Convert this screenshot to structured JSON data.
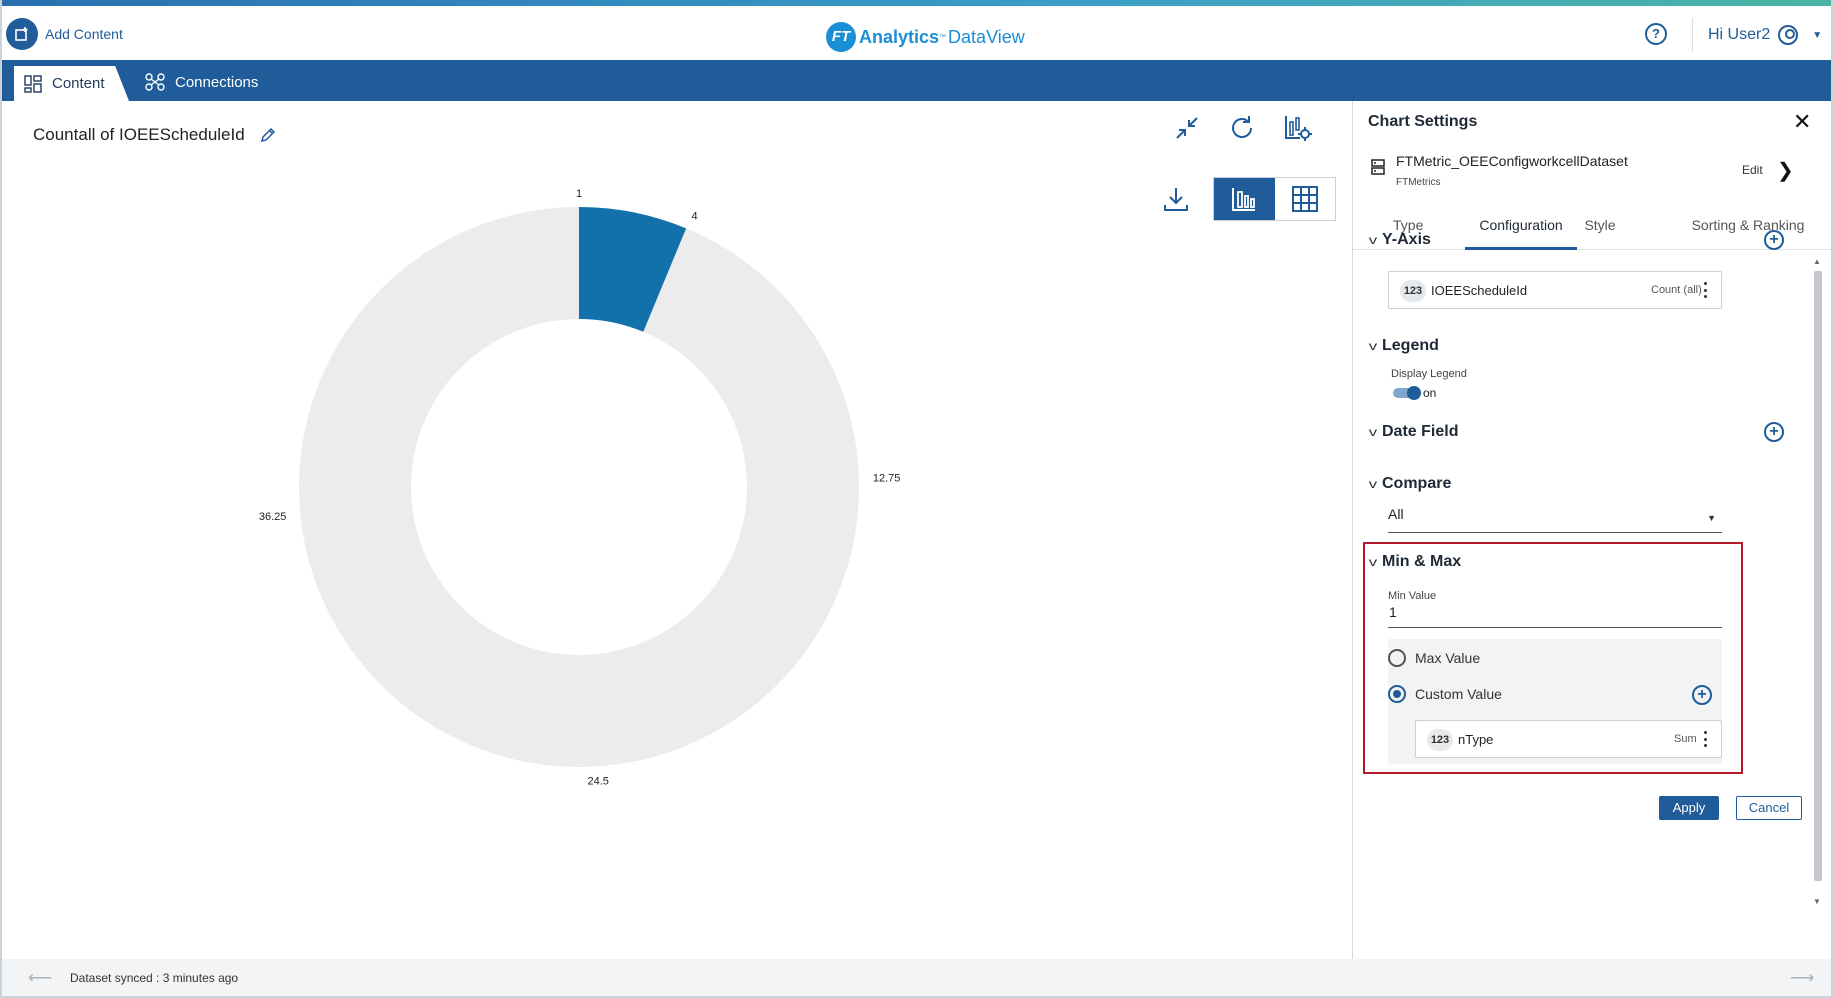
{
  "header": {
    "add_content_label": "Add Content",
    "brand_badge": "FT",
    "brand_analytics": "Analytics",
    "brand_tm": "™",
    "brand_dataview": "DataView",
    "help_icon": "question-circle-icon",
    "user_greeting": "Hi User2"
  },
  "tabs": [
    {
      "label": "Content",
      "icon": "grid-icon",
      "active": true
    },
    {
      "label": "Connections",
      "icon": "connections-icon",
      "active": false
    }
  ],
  "main": {
    "chart_title": "Countall of IOEEScheduleId"
  },
  "chart_data": {
    "type": "donut",
    "title": "Countall of IOEEScheduleId",
    "value": 4,
    "min": 1,
    "max": 49,
    "gauge_labels": [
      "1",
      "4",
      "12.75",
      "24.5",
      "36.25"
    ],
    "colors": {
      "filled": "#1270aa",
      "track": "#ececec"
    }
  },
  "footer": {
    "status_text": "Dataset synced : 3 minutes ago"
  },
  "panel": {
    "title": "Chart Settings",
    "dataset_name": "FTMetric_OEEConfigworkcellDataset",
    "dataset_source": "FTMetrics",
    "edit_label": "Edit",
    "tabs": [
      "Type",
      "Configuration",
      "Style",
      "Sorting & Ranking"
    ],
    "active_tab": "Configuration",
    "y_axis": {
      "title": "Y-Axis",
      "field_type": "123",
      "field_name": "IOEEScheduleId",
      "aggregation": "Count (all)"
    },
    "legend": {
      "title": "Legend",
      "display_label": "Display Legend",
      "state": "on"
    },
    "date_field": {
      "title": "Date Field"
    },
    "compare": {
      "title": "Compare",
      "value": "All"
    },
    "min_max": {
      "title": "Min & Max",
      "min_label": "Min Value",
      "min_value": "1",
      "option_max": "Max Value",
      "option_custom": "Custom Value",
      "selected": "Custom Value",
      "custom_field_type": "123",
      "custom_field_name": "nType",
      "custom_aggregation": "Sum"
    },
    "apply_label": "Apply",
    "cancel_label": "Cancel"
  },
  "colors": {
    "brand": "#1f5c99",
    "highlight_border": "#b3192a"
  }
}
